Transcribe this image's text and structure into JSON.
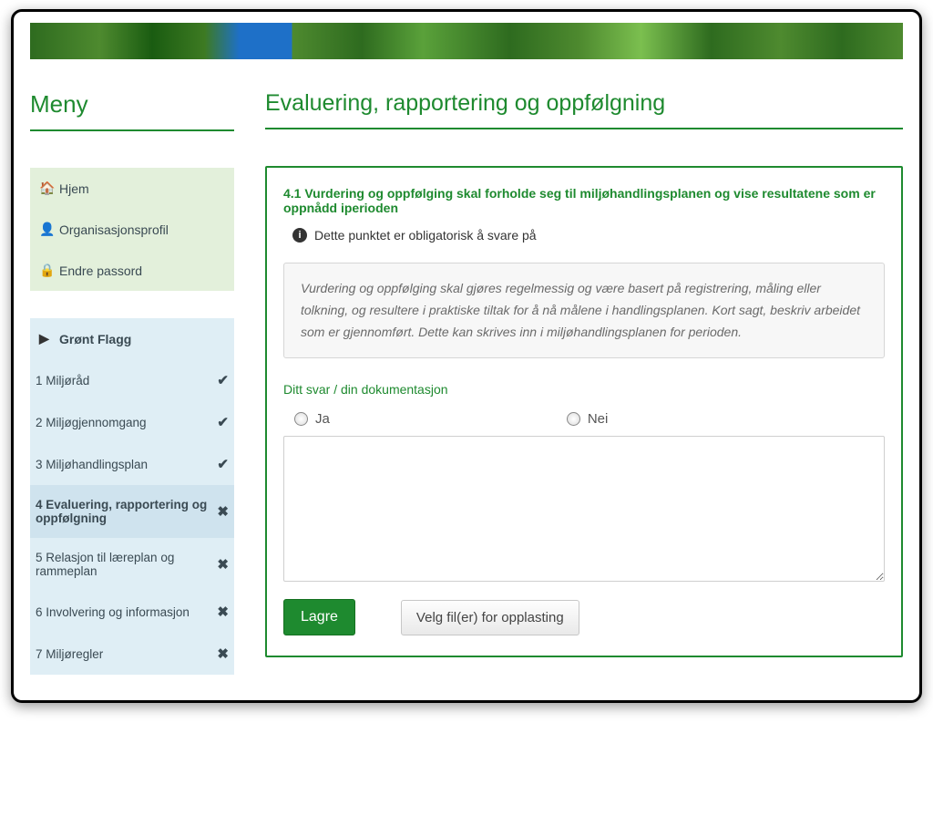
{
  "menu_title": "Meny",
  "page_title": "Evaluering, rapportering og oppfølgning",
  "nav_green": {
    "home": {
      "label": "Hjem"
    },
    "org": {
      "label": "Organisasjonsprofil"
    },
    "passwd": {
      "label": "Endre passord"
    }
  },
  "nav_blue": {
    "header": "Grønt Flagg",
    "steps": [
      {
        "label": "1 Miljøråd",
        "status": "✔"
      },
      {
        "label": "2 Miljøgjennomgang",
        "status": "✔"
      },
      {
        "label": "3 Miljøhandlingsplan",
        "status": "✔"
      },
      {
        "label": "4 Evaluering, rapportering og oppfølgning",
        "status": "✖",
        "selected": true
      },
      {
        "label": "5 Relasjon til læreplan og rammeplan",
        "status": "✖"
      },
      {
        "label": "6 Involvering og informasjon",
        "status": "✖"
      },
      {
        "label": "7 Miljøregler",
        "status": "✖"
      }
    ]
  },
  "question": {
    "number_title": "4.1 Vurdering og oppfølging skal forholde seg til miljøhandlingsplanen og vise resultatene som er oppnådd iperioden",
    "mandatory_text": "Dette punktet er obligatorisk å svare på",
    "instruction": "Vurdering og oppfølging skal gjøres regelmessig og være basert på registrering, måling eller tolkning, og resultere i praktiske tiltak for å nå målene i handlingsplanen. Kort sagt, beskriv arbeidet som er gjennomført. Dette kan skrives inn i miljøhandlingsplanen for perioden.",
    "answer_label": "Ditt svar / din dokumentasjon",
    "option_yes": "Ja",
    "option_no": "Nei",
    "textarea_value": ""
  },
  "buttons": {
    "save": "Lagre",
    "upload": "Velg fil(er) for opplasting"
  },
  "icons": {
    "home": "⌂",
    "user": "👤",
    "lock": "🔒",
    "play": "▶",
    "info": "i",
    "hand": "☝"
  }
}
